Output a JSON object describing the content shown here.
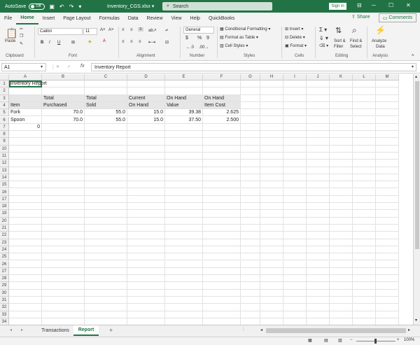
{
  "titlebar": {
    "autosave_label": "AutoSave",
    "autosave_state": "Off",
    "file_name": "Inventory_CGS.xlsx",
    "search_placeholder": "Search",
    "signin_label": "Sign in",
    "minimize": "─",
    "maximize": "☐",
    "close": "✕"
  },
  "menu": {
    "tabs": [
      "File",
      "Home",
      "Insert",
      "Page Layout",
      "Formulas",
      "Data",
      "Review",
      "View",
      "Help",
      "QuickBooks"
    ],
    "active": "Home",
    "share_label": "Share",
    "comments_label": "Comments"
  },
  "ribbon": {
    "clipboard": {
      "label": "Clipboard",
      "paste": "Paste"
    },
    "font": {
      "label": "Font",
      "name": "Calibri",
      "size": "11",
      "bold": "B",
      "italic": "I",
      "underline": "U"
    },
    "alignment": {
      "label": "Alignment"
    },
    "number": {
      "label": "Number",
      "format": "General",
      "currency": "$",
      "percent": "%",
      "comma": "9"
    },
    "styles": {
      "label": "Styles",
      "conditional": "Conditional Formatting",
      "format_table": "Format as Table",
      "cell_styles": "Cell Styles"
    },
    "cells": {
      "label": "Cells",
      "insert": "Insert",
      "delete": "Delete",
      "format": "Format"
    },
    "editing": {
      "label": "Editing",
      "sort_filter_1": "Sort &",
      "sort_filter_2": "Filter",
      "find_select_1": "Find &",
      "find_select_2": "Select"
    },
    "analysis": {
      "label": "Analysis",
      "analyze_1": "Analyze",
      "analyze_2": "Data"
    }
  },
  "formula_bar": {
    "name_box": "A1",
    "fx": "fx",
    "content": "Inventory Report"
  },
  "sheet": {
    "columns": [
      "A",
      "B",
      "C",
      "D",
      "E",
      "F",
      "G",
      "H",
      "I",
      "J",
      "K",
      "L",
      "M"
    ],
    "rows": [
      "1",
      "2",
      "3",
      "4",
      "5",
      "6",
      "7",
      "8",
      "9",
      "10",
      "11",
      "12",
      "13",
      "14",
      "15",
      "16",
      "17",
      "18",
      "19",
      "20",
      "21",
      "22",
      "23",
      "24",
      "25",
      "26",
      "27",
      "28",
      "29",
      "30",
      "31",
      "32",
      "33",
      "34"
    ],
    "cells": {
      "A1": "Inventory Report",
      "B3": "Total",
      "C3": "Total",
      "D3": "Current",
      "E3": "On Hand",
      "F3": "On Hand",
      "A4": "Item",
      "B4": "Purchased",
      "C4": "Sold",
      "D4": "On Hand",
      "E4": "Value",
      "F4": "Item Cost",
      "A5": "Fork",
      "B5": "70.0",
      "C5": "55.0",
      "D5": "15.0",
      "E5": "39.38",
      "F5": "2.625",
      "A6": "Spoon",
      "B6": "70.0",
      "C6": "55.0",
      "D6": "15.0",
      "E6": "37.50",
      "F6": "2.500",
      "A7": "0"
    }
  },
  "sheet_tabs": {
    "tabs": [
      "Transactions",
      "Report"
    ],
    "active": "Report",
    "add": "+"
  },
  "status": {
    "zoom": "100%",
    "minus": "−",
    "plus": "+"
  }
}
